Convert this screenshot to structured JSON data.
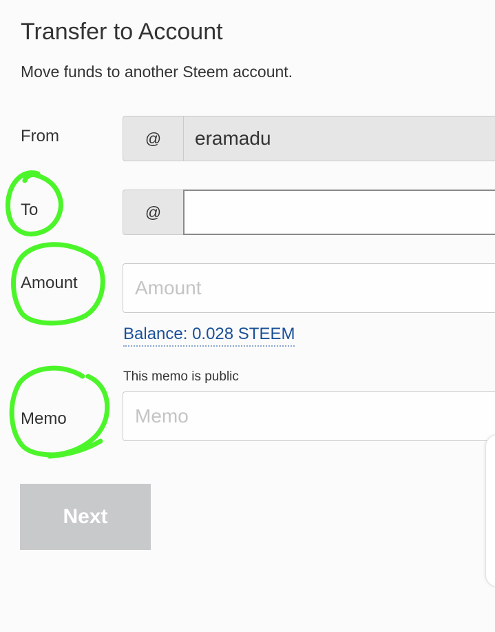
{
  "header": {
    "title": "Transfer to Account",
    "subtitle": "Move funds to another Steem account."
  },
  "form": {
    "from": {
      "label": "From",
      "prefix": "@",
      "value": "eramadu"
    },
    "to": {
      "label": "To",
      "prefix": "@",
      "value": ""
    },
    "amount": {
      "label": "Amount",
      "placeholder": "Amount",
      "balance_text": "Balance: 0.028 STEEM"
    },
    "memo": {
      "label": "Memo",
      "note": "This memo is public",
      "placeholder": "Memo"
    },
    "next_label": "Next"
  },
  "colors": {
    "highlight": "#4cf52a",
    "link": "#1a5099",
    "button_disabled": "#c8c9cb",
    "addon_background": "#e6e6e6"
  }
}
